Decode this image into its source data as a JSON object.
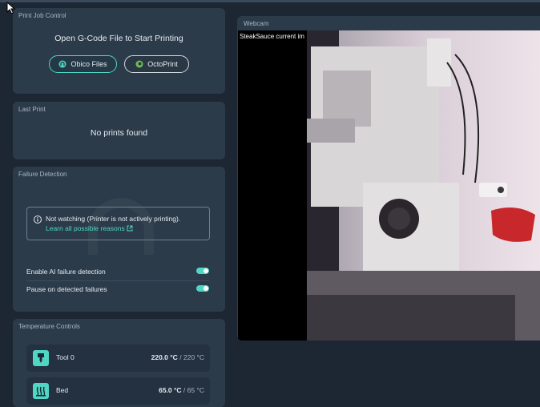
{
  "print_job": {
    "title": "Print Job Control",
    "heading": "Open G-Code File to Start Printing",
    "obico_button": "Obico Files",
    "octoprint_button": "OctoPrint"
  },
  "last_print": {
    "title": "Last Print",
    "message": "No prints found"
  },
  "failure": {
    "title": "Failure Detection",
    "notice": "Not watching (Printer is not actively printing).",
    "link": "Learn all possible reasons",
    "toggles": [
      {
        "label": "Enable AI failure detection",
        "on": true
      },
      {
        "label": "Pause on detected failures",
        "on": true
      }
    ]
  },
  "temperature": {
    "title": "Temperature Controls",
    "rows": [
      {
        "name": "Tool 0",
        "actual": "220.0 °C",
        "target": "/ 220 °C",
        "icon": "nozzle-icon"
      },
      {
        "name": "Bed",
        "actual": "65.0 °C",
        "target": "/ 65 °C",
        "icon": "heat-bed-icon"
      }
    ]
  },
  "webcam": {
    "title": "Webcam",
    "caption": "SteakSauce current im"
  },
  "colors": {
    "accent": "#4fd6c4",
    "card": "#2c3b4a",
    "background": "#1d2733"
  }
}
